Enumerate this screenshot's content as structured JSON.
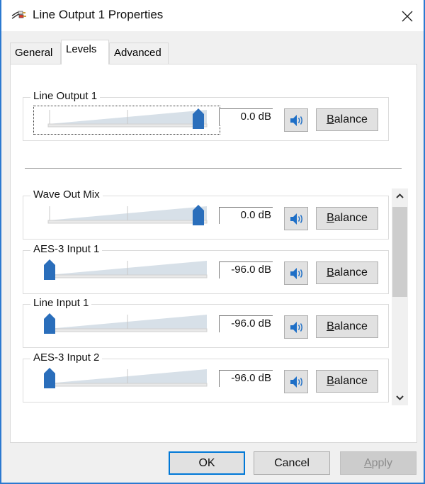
{
  "window": {
    "title": "Line Output 1 Properties",
    "icon": "audio-cable-icon",
    "close_icon": "close-icon"
  },
  "tabs": [
    {
      "label": "General",
      "active": false
    },
    {
      "label": "Levels",
      "active": true
    },
    {
      "label": "Advanced",
      "active": false
    }
  ],
  "master": {
    "label": "Line Output 1",
    "level_fraction": 1.0,
    "value": "0.0 dB",
    "mute_icon": "speaker-icon",
    "balance_label_underlined": "B",
    "balance_label_rest": "alance",
    "focused": true
  },
  "channels": [
    {
      "label": "Wave Out Mix",
      "level_fraction": 1.0,
      "value": "0.0 dB"
    },
    {
      "label": "AES-3 Input 1",
      "level_fraction": 0.0,
      "value": "-96.0 dB"
    },
    {
      "label": "Line Input 1",
      "level_fraction": 0.0,
      "value": "-96.0 dB"
    },
    {
      "label": "AES-3 Input 2",
      "level_fraction": 0.0,
      "value": "-96.0 dB"
    }
  ],
  "balance": {
    "underlined": "B",
    "rest": "alance"
  },
  "scrollbar": {
    "up_icon": "chevron-up-icon",
    "down_icon": "chevron-down-icon"
  },
  "buttons": {
    "ok": "OK",
    "cancel": "Cancel",
    "apply_underlined": "A",
    "apply_rest": "pply",
    "apply_disabled": true
  },
  "colors": {
    "accent": "#2b79d0",
    "thumb": "#2a6ebb",
    "wedge": "#d7e0e8"
  }
}
